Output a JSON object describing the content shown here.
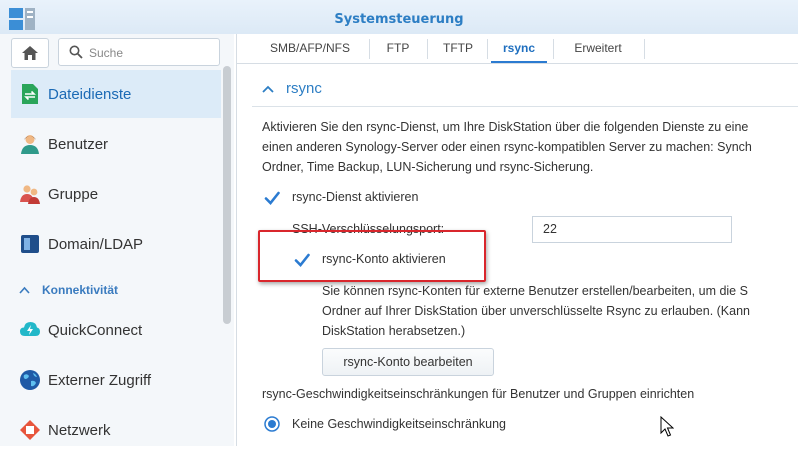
{
  "window": {
    "title": "Systemsteuerung"
  },
  "sidebar": {
    "search_placeholder": "Suche",
    "items": [
      {
        "label": "Dateidienste",
        "icon": "file-services-icon",
        "active": true
      },
      {
        "label": "Benutzer",
        "icon": "user-icon"
      },
      {
        "label": "Gruppe",
        "icon": "group-icon"
      },
      {
        "label": "Domain/LDAP",
        "icon": "domain-icon"
      }
    ],
    "section": "Konnektivität",
    "section_items": [
      {
        "label": "QuickConnect",
        "icon": "quickconnect-icon"
      },
      {
        "label": "Externer Zugriff",
        "icon": "globe-icon"
      },
      {
        "label": "Netzwerk",
        "icon": "network-icon"
      }
    ]
  },
  "tabs": [
    "SMB/AFP/NFS",
    "FTP",
    "TFTP",
    "rsync",
    "Erweitert"
  ],
  "active_tab": "rsync",
  "main": {
    "section_title": "rsync",
    "description": [
      "Aktivieren Sie den rsync-Dienst, um Ihre DiskStation über die folgenden Dienste zu eine",
      "einen anderen Synology-Server oder einen rsync-kompatiblen Server zu machen: Synch",
      "Ordner, Time Backup, LUN-Sicherung und rsync-Sicherung."
    ],
    "enable_rsync_label": "rsync-Dienst aktivieren",
    "enable_rsync_checked": true,
    "ssh_port_label": "SSH-Verschlüsselungsport:",
    "ssh_port_value": "22",
    "enable_account_label": "rsync-Konto aktivieren",
    "enable_account_checked": true,
    "account_description": [
      "Sie können rsync-Konten für externe Benutzer erstellen/bearbeiten, um die S",
      "Ordner auf Ihrer DiskStation über unverschlüsselte Rsync zu erlauben. (Kann",
      "DiskStation herabsetzen.)"
    ],
    "edit_account_button": "rsync-Konto bearbeiten",
    "speed_limit_label": "rsync-Geschwindigkeitseinschränkungen für Benutzer und Gruppen einrichten",
    "no_limit_label": "Keine Geschwindigkeitseinschränkung",
    "no_limit_selected": true
  },
  "colors": {
    "accent": "#2d7ec4",
    "highlight": "#d9262c",
    "active_bg": "#dcebf8"
  }
}
